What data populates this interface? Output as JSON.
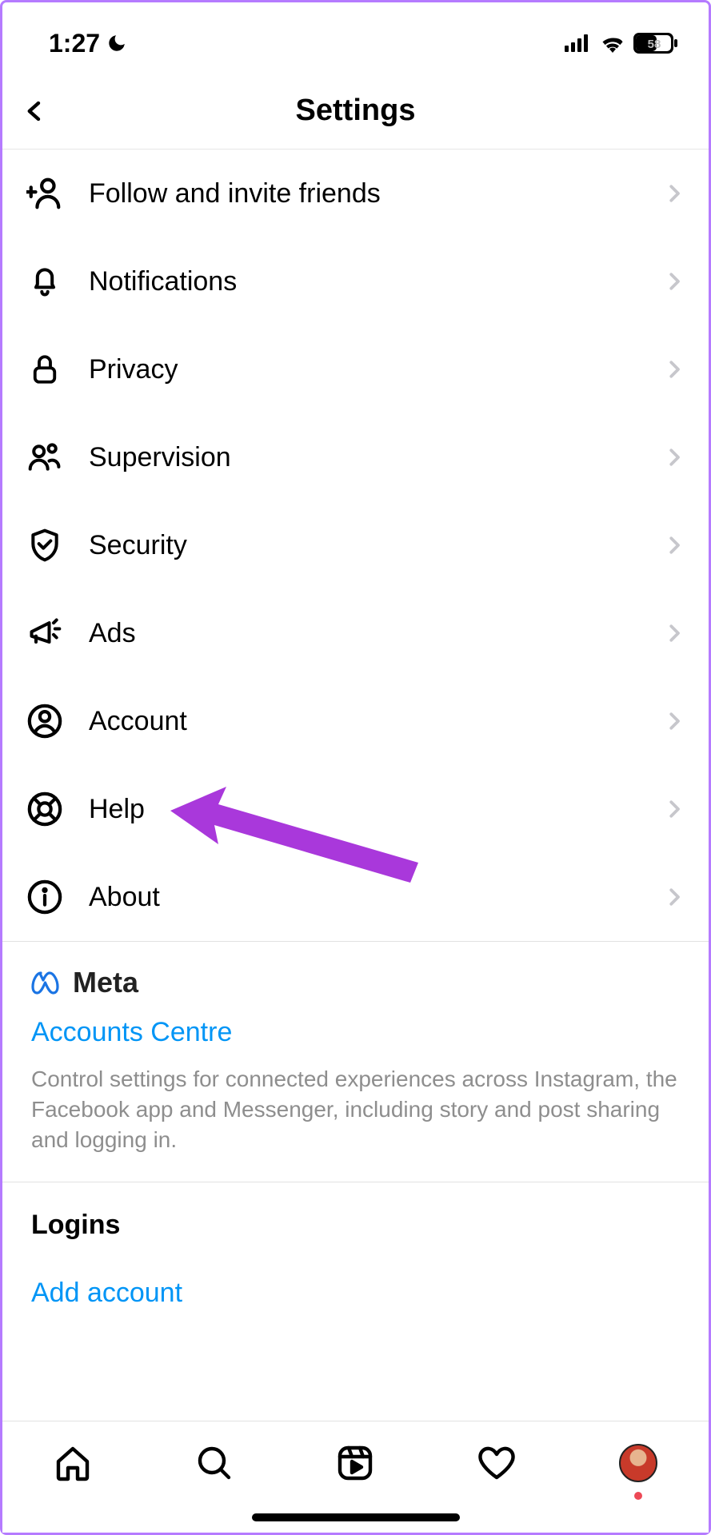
{
  "status": {
    "time": "1:27",
    "battery": "58"
  },
  "header": {
    "title": "Settings"
  },
  "settings": {
    "items": [
      {
        "label": "Follow and invite friends"
      },
      {
        "label": "Notifications"
      },
      {
        "label": "Privacy"
      },
      {
        "label": "Supervision"
      },
      {
        "label": "Security"
      },
      {
        "label": "Ads"
      },
      {
        "label": "Account"
      },
      {
        "label": "Help"
      },
      {
        "label": "About"
      }
    ]
  },
  "meta": {
    "brand": "Meta",
    "accounts_link": "Accounts Centre",
    "description": "Control settings for connected experiences across Instagram, the Facebook app and Messenger, including story and post sharing and logging in."
  },
  "logins": {
    "title": "Logins",
    "add_account": "Add account"
  }
}
